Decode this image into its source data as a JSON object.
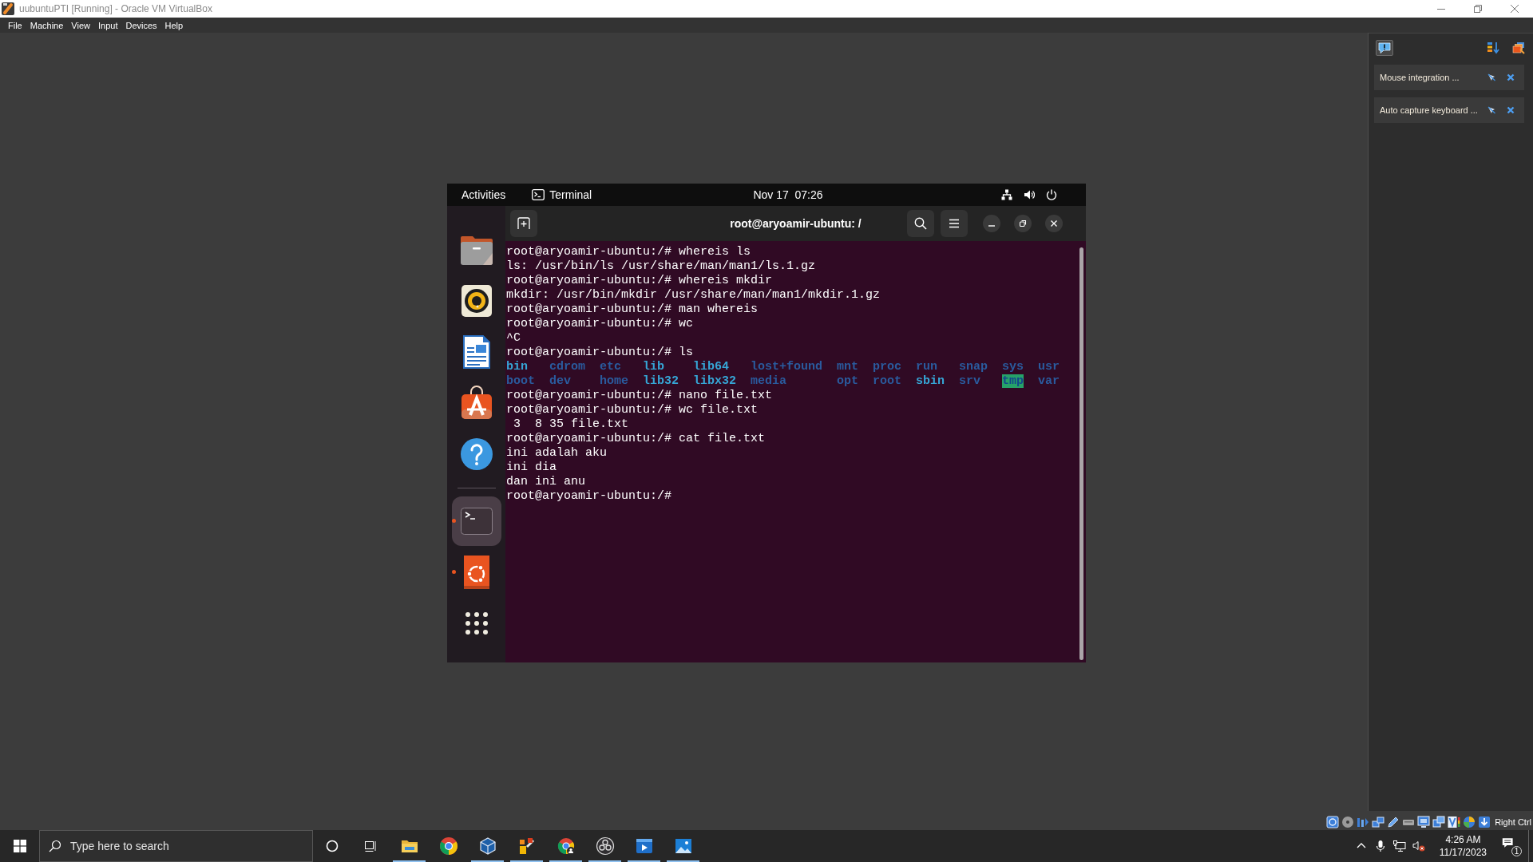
{
  "window": {
    "title": "uubuntuPTI [Running] - Oracle VM VirtualBox"
  },
  "menu": [
    "File",
    "Machine",
    "View",
    "Input",
    "Devices",
    "Help"
  ],
  "vm": {
    "top_bar": {
      "activities": "Activities",
      "app": "Terminal",
      "clock": "Nov 17  07:26"
    },
    "dock": {
      "favorites": [
        {
          "kind": "files",
          "running": false,
          "selected": false
        },
        {
          "kind": "music",
          "running": false,
          "selected": false
        },
        {
          "kind": "writer",
          "running": false,
          "selected": false
        },
        {
          "kind": "store",
          "running": false,
          "selected": false
        },
        {
          "kind": "help",
          "running": false,
          "selected": false
        }
      ],
      "others": [
        {
          "kind": "terminal",
          "running": true,
          "selected": true
        },
        {
          "kind": "ubuntu",
          "running": true,
          "selected": false
        }
      ]
    },
    "terminal": {
      "title": "root@aryoamir-ubuntu: /",
      "lines": [
        {
          "kind": "text",
          "text": "root@aryoamir-ubuntu:/# whereis ls"
        },
        {
          "kind": "text",
          "text": "ls: /usr/bin/ls /usr/share/man/man1/ls.1.gz"
        },
        {
          "kind": "text",
          "text": "root@aryoamir-ubuntu:/# whereis mkdir"
        },
        {
          "kind": "text",
          "text": "mkdir: /usr/bin/mkdir /usr/share/man/man1/mkdir.1.gz"
        },
        {
          "kind": "text",
          "text": "root@aryoamir-ubuntu:/# man whereis"
        },
        {
          "kind": "text",
          "text": "root@aryoamir-ubuntu:/# wc"
        },
        {
          "kind": "text",
          "text": "^C"
        },
        {
          "kind": "text",
          "text": "root@aryoamir-ubuntu:/# ls"
        },
        {
          "kind": "listing",
          "entries": [
            {
              "name": "bin",
              "kind": "link"
            },
            {
              "name": "cdrom",
              "kind": "dir"
            },
            {
              "name": "etc",
              "kind": "dir"
            },
            {
              "name": "lib",
              "kind": "link"
            },
            {
              "name": "lib64",
              "kind": "link"
            },
            {
              "name": "lost+found",
              "kind": "dir"
            },
            {
              "name": "mnt",
              "kind": "dir"
            },
            {
              "name": "proc",
              "kind": "dir"
            },
            {
              "name": "run",
              "kind": "dir"
            },
            {
              "name": "snap",
              "kind": "dir"
            },
            {
              "name": "sys",
              "kind": "dir"
            },
            {
              "name": "usr",
              "kind": "dir"
            }
          ]
        },
        {
          "kind": "listing",
          "entries": [
            {
              "name": "boot",
              "kind": "dir"
            },
            {
              "name": "dev",
              "kind": "dir"
            },
            {
              "name": "home",
              "kind": "dir"
            },
            {
              "name": "lib32",
              "kind": "link"
            },
            {
              "name": "libx32",
              "kind": "link"
            },
            {
              "name": "media",
              "kind": "dir"
            },
            {
              "name": "opt",
              "kind": "dir"
            },
            {
              "name": "root",
              "kind": "dir"
            },
            {
              "name": "sbin",
              "kind": "link"
            },
            {
              "name": "srv",
              "kind": "dir"
            },
            {
              "name": "tmp",
              "kind": "sticky"
            },
            {
              "name": "var",
              "kind": "dir"
            }
          ]
        },
        {
          "kind": "text",
          "text": "root@aryoamir-ubuntu:/# nano file.txt"
        },
        {
          "kind": "text",
          "text": "root@aryoamir-ubuntu:/# wc file.txt"
        },
        {
          "kind": "text",
          "text": " 3  8 35 file.txt"
        },
        {
          "kind": "text",
          "text": "root@aryoamir-ubuntu:/# cat file.txt"
        },
        {
          "kind": "text",
          "text": "ini adalah aku"
        },
        {
          "kind": "text",
          "text": "ini dia"
        },
        {
          "kind": "text",
          "text": "dan ini anu"
        },
        {
          "kind": "text",
          "text": "root@aryoamir-ubuntu:/#"
        }
      ]
    }
  },
  "notification_center": {
    "toggle_on": true,
    "items": [
      {
        "text": "Mouse integration ..."
      },
      {
        "text": "Auto capture keyboard ..."
      }
    ]
  },
  "status_bar": {
    "host_key": "Right Ctrl"
  },
  "taskbar": {
    "search": {
      "placeholder": "Type here to search"
    },
    "apps": [
      {
        "kind": "explorer",
        "running": true
      },
      {
        "kind": "browser",
        "running": false
      },
      {
        "kind": "cube",
        "running": true
      },
      {
        "kind": "tool",
        "running": true
      },
      {
        "kind": "profile_browser",
        "running": true
      },
      {
        "kind": "recorder",
        "running": true
      },
      {
        "kind": "player",
        "running": true
      },
      {
        "kind": "photos",
        "running": true
      }
    ],
    "clock": {
      "time": "4:26 AM",
      "date": "11/17/2023"
    },
    "notifications": "1"
  }
}
